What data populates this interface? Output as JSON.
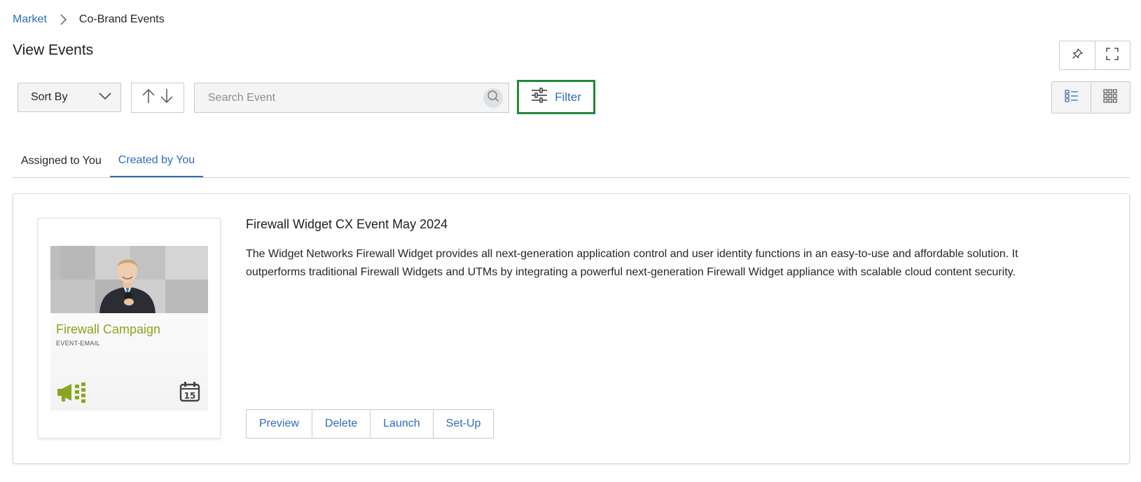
{
  "breadcrumb": {
    "parent": "Market",
    "current": "Co-Brand Events"
  },
  "page": {
    "title": "View Events"
  },
  "toolbar": {
    "sort_label": "Sort By",
    "search_placeholder": "Search Event",
    "filter_label": "Filter"
  },
  "tabs": [
    {
      "label": "Assigned to You",
      "active": false
    },
    {
      "label": "Created by You",
      "active": true
    }
  ],
  "event": {
    "title": "Firewall Widget CX Event May 2024",
    "description": "The Widget Networks Firewall Widget provides all next-generation application control and user identity functions in an easy-to-use and affordable solution. It outperforms traditional Firewall Widgets and UTMs by integrating a powerful next-generation Firewall Widget appliance with scalable cloud content security.",
    "thumbnail": {
      "campaign_title": "Firewall Campaign",
      "campaign_type": "EVENT-EMAIL",
      "calendar_day": "15"
    },
    "actions": [
      "Preview",
      "Delete",
      "Launch",
      "Set-Up"
    ]
  },
  "colors": {
    "link_blue": "#2f6bbf",
    "filter_highlight": "#1e8a3a",
    "campaign_green": "#8aa520"
  },
  "icons": [
    "chevron-right-icon",
    "pin-icon",
    "fullscreen-icon",
    "chevron-down-icon",
    "sort-up-icon",
    "sort-down-icon",
    "search-icon",
    "filter-sliders-icon",
    "list-view-icon",
    "grid-view-icon",
    "megaphone-icon",
    "calendar-icon"
  ]
}
